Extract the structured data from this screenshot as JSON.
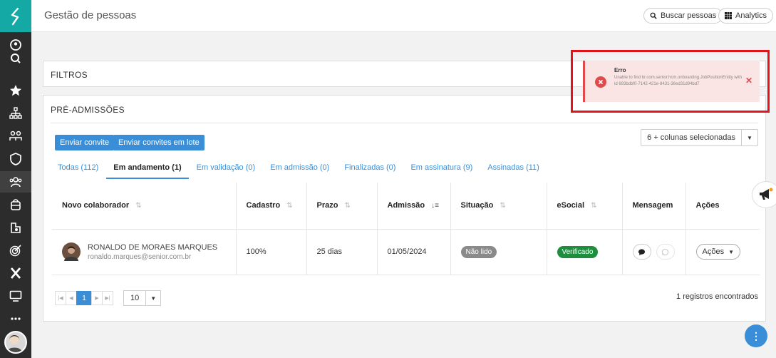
{
  "header": {
    "title": "Gestão de pessoas",
    "search_label": "Buscar pessoas",
    "analytics_label": "Analytics"
  },
  "filters": {
    "title": "FILTROS"
  },
  "pre": {
    "title": "PRÉ-ADMISSÕES",
    "invite_label": "Enviar convite",
    "invite_batch_label": "Enviar convites em lote",
    "columns_label": "6 + colunas selecionadas",
    "tabs": [
      {
        "label": "Todas (112)"
      },
      {
        "label": "Em andamento (1)"
      },
      {
        "label": "Em validação (0)"
      },
      {
        "label": "Em admissão (0)"
      },
      {
        "label": "Finalizadas (0)"
      },
      {
        "label": "Em assinatura (9)"
      },
      {
        "label": "Assinadas (11)"
      }
    ],
    "columns": [
      "Novo colaborador",
      "Cadastro",
      "Prazo",
      "Admissão",
      "Situação",
      "eSocial",
      "Mensagem",
      "Ações"
    ],
    "row": {
      "name": "RONALDO DE MORAES MARQUES",
      "email": "ronaldo.marques@senior.com.br",
      "cadastro": "100%",
      "prazo": "25 dias",
      "admissao": "01/05/2024",
      "situacao": "Não lido",
      "esocial": "Verificado",
      "acoes": "Ações"
    },
    "pager": {
      "current": "1",
      "per_page": "10"
    },
    "records": "1 registros encontrados"
  },
  "toast": {
    "title": "Erro",
    "message": "Unable to find br.com.senior.hcm.onboarding.JobPositionEntity with id 693bdbf0-7142-421e-8431-36ed31d94bd7"
  },
  "colors": {
    "teal": "#14a9a4",
    "primary": "#3a8ed8",
    "situacao_badge": "#8a8a8a",
    "esocial_badge": "#1e8e3e",
    "error": "#e14a4a"
  }
}
